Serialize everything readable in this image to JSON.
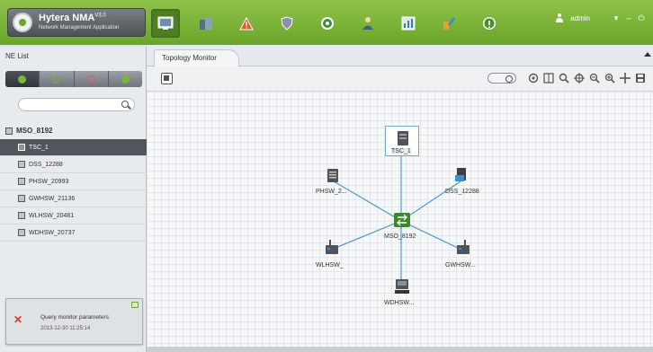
{
  "brand": {
    "name": "Hytera NMA",
    "version": "V3.0",
    "subtitle": "Network Management Application"
  },
  "toolbar": {
    "buttons": [
      {
        "icon": "topology-icon",
        "active": true
      },
      {
        "icon": "equipment-icon",
        "active": false
      },
      {
        "icon": "alarm-icon",
        "active": false
      },
      {
        "icon": "security-shield-icon",
        "active": false
      },
      {
        "icon": "status-icon",
        "active": false
      },
      {
        "icon": "user-management-icon",
        "active": false
      },
      {
        "icon": "report-icon",
        "active": false
      },
      {
        "icon": "tools-icon",
        "active": false
      },
      {
        "icon": "info-icon",
        "active": false
      }
    ],
    "colors": {
      "header": "#7cb53a",
      "active_button": "#4f7f24"
    }
  },
  "user": {
    "name": "admin"
  },
  "window_controls": {
    "menu": "▾",
    "minimize": "–",
    "close": "⏻"
  },
  "ne_list": {
    "title": "NE List",
    "filters": [
      {
        "icon": "all-filter-icon",
        "color": "#7cb53a"
      },
      {
        "icon": "normal-filter-icon",
        "color": "#7cb53a"
      },
      {
        "icon": "offline-filter-icon",
        "color": "#e25a4a"
      },
      {
        "icon": "alarm-filter-icon",
        "color": "#7cb53a"
      }
    ],
    "search": {
      "placeholder": "",
      "value": ""
    },
    "root": {
      "label": "MSO_8192"
    },
    "items": [
      {
        "label": "TSC_1",
        "icon": "tsc-icon",
        "selected": true
      },
      {
        "label": "DSS_12288",
        "icon": "dss-icon",
        "selected": false
      },
      {
        "label": "PHSW_20993",
        "icon": "phsw-icon",
        "selected": false
      },
      {
        "label": "GWHSW_21136",
        "icon": "gwhsw-icon",
        "selected": false
      },
      {
        "label": "WLHSW_20481",
        "icon": "wlhsw-icon",
        "selected": false
      },
      {
        "label": "WDHSW_20737",
        "icon": "wdhsw-icon",
        "selected": false
      }
    ]
  },
  "notification": {
    "message": "Query monitor parameters",
    "time": "2013-12-30 11:25:14",
    "status_color": "#d13b2c"
  },
  "tabs": [
    {
      "label": "Topology Monitor"
    }
  ],
  "topology": {
    "center": {
      "label": "MSO_8192",
      "icon": "mso-switch-icon"
    },
    "nodes": [
      {
        "id": "tsc",
        "label": "TSC_1",
        "icon": "tsc-server-icon",
        "selected": true
      },
      {
        "id": "phsw",
        "label": "PHSW_2...",
        "icon": "phsw-device-icon"
      },
      {
        "id": "dss",
        "label": "DSS_12288",
        "icon": "dss-computer-icon"
      },
      {
        "id": "wlhsw",
        "label": "WLHSW_",
        "icon": "wlhsw-device-icon"
      },
      {
        "id": "gwhsw",
        "label": "GWHSW...",
        "icon": "gwhsw-device-icon"
      },
      {
        "id": "wdhsw",
        "label": "WDHSW...",
        "icon": "wdhsw-device-icon"
      }
    ],
    "link_color": "#4a9ad0",
    "tools": [
      "toggle-switch-icon",
      "settings-icon",
      "layout-icon",
      "search-zoom-icon",
      "locate-icon",
      "zoom-out-icon",
      "zoom-in-icon",
      "pan-icon",
      "save-icon"
    ]
  }
}
